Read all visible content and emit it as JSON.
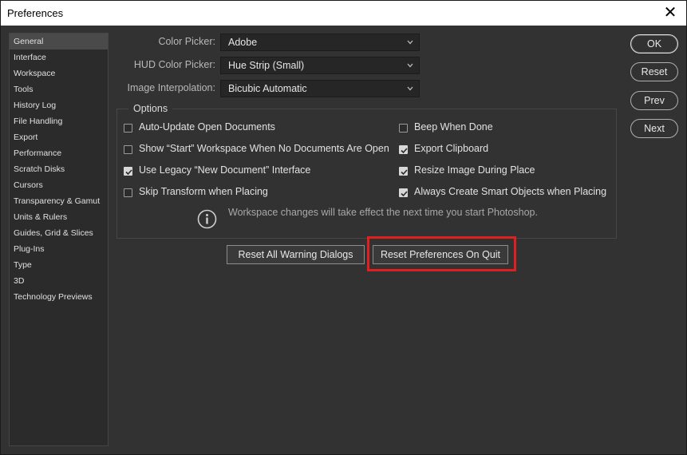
{
  "window": {
    "title": "Preferences",
    "close_glyph": "✕"
  },
  "sidebar": {
    "items": [
      {
        "label": "General",
        "active": true
      },
      {
        "label": "Interface"
      },
      {
        "label": "Workspace"
      },
      {
        "label": "Tools"
      },
      {
        "label": "History Log"
      },
      {
        "label": "File Handling"
      },
      {
        "label": "Export"
      },
      {
        "label": "Performance"
      },
      {
        "label": "Scratch Disks"
      },
      {
        "label": "Cursors"
      },
      {
        "label": "Transparency & Gamut"
      },
      {
        "label": "Units & Rulers"
      },
      {
        "label": "Guides, Grid & Slices"
      },
      {
        "label": "Plug-Ins"
      },
      {
        "label": "Type"
      },
      {
        "label": "3D"
      },
      {
        "label": "Technology Previews"
      }
    ]
  },
  "fields": {
    "color_picker": {
      "label": "Color Picker:",
      "value": "Adobe"
    },
    "hud_color_picker": {
      "label": "HUD Color Picker:",
      "value": "Hue Strip (Small)"
    },
    "image_interpolation": {
      "label": "Image Interpolation:",
      "value": "Bicubic Automatic"
    }
  },
  "options": {
    "legend": "Options",
    "left": [
      {
        "label": "Auto-Update Open Documents",
        "checked": false
      },
      {
        "label": "Show “Start” Workspace When No Documents Are Open",
        "checked": false
      },
      {
        "label": "Use Legacy “New Document” Interface",
        "checked": true
      },
      {
        "label": "Skip Transform when Placing",
        "checked": false
      }
    ],
    "right": [
      {
        "label": "Beep When Done",
        "checked": false
      },
      {
        "label": "Export Clipboard",
        "checked": true
      },
      {
        "label": "Resize Image During Place",
        "checked": true
      },
      {
        "label": "Always Create Smart Objects when Placing",
        "checked": true
      }
    ],
    "info": "Workspace changes will take effect the next time you start Photoshop."
  },
  "buttons": {
    "reset_warnings": "Reset All Warning Dialogs",
    "reset_prefs": "Reset Preferences On Quit",
    "ok": "OK",
    "reset": "Reset",
    "prev": "Prev",
    "next": "Next"
  },
  "colors": {
    "highlight": "#e02020",
    "panel": "#323232",
    "sidebar": "#2b2b2b"
  }
}
